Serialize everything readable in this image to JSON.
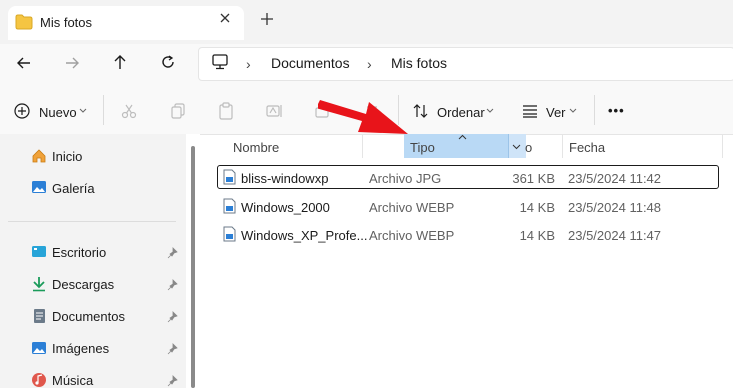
{
  "window": {
    "tab_title": "Mis fotos",
    "icons": {
      "tab": "folder-icon",
      "close": "close-icon",
      "new_tab": "plus-icon"
    }
  },
  "nav": {
    "icons": [
      "back-arrow-icon",
      "forward-arrow-icon",
      "up-arrow-icon",
      "refresh-icon",
      "computer-icon"
    ],
    "breadcrumb": [
      "Documentos",
      "Mis fotos"
    ]
  },
  "command_bar": {
    "new_label": "Nuevo",
    "sort_label": "Ordenar",
    "view_label": "Ver",
    "more_label": "•••",
    "icons": [
      "cut-icon",
      "copy-icon",
      "paste-icon",
      "rename-icon",
      "share-icon"
    ]
  },
  "sidebar": {
    "top_items": [
      {
        "label": "Inicio",
        "icon": "home-icon"
      },
      {
        "label": "Galería",
        "icon": "gallery-icon"
      }
    ],
    "pinned_items": [
      {
        "label": "Escritorio",
        "icon": "desktop-icon"
      },
      {
        "label": "Descargas",
        "icon": "download-icon"
      },
      {
        "label": "Documentos",
        "icon": "document-icon"
      },
      {
        "label": "Imágenes",
        "icon": "pictures-icon"
      },
      {
        "label": "Música",
        "icon": "music-icon"
      }
    ]
  },
  "file_list": {
    "columns": {
      "name": "Nombre",
      "type": "Tipo",
      "size_partial": "o",
      "date": "Fecha"
    },
    "sorted_by": "Tipo",
    "rows": [
      {
        "name": "bliss-windowxp",
        "type": "Archivo JPG",
        "size": "361 KB",
        "date": "23/5/2024 11:42",
        "selected": true
      },
      {
        "name": "Windows_2000",
        "type": "Archivo WEBP",
        "size": "14 KB",
        "date": "23/5/2024 11:48",
        "selected": false
      },
      {
        "name": "Windows_XP_Profe...",
        "type": "Archivo WEBP",
        "size": "14 KB",
        "date": "23/5/2024 11:47",
        "selected": false
      }
    ]
  },
  "colors": {
    "annotation_arrow": "#e8141a",
    "selection_highlight": "#b9d9f5",
    "folder": "#f5c542"
  }
}
